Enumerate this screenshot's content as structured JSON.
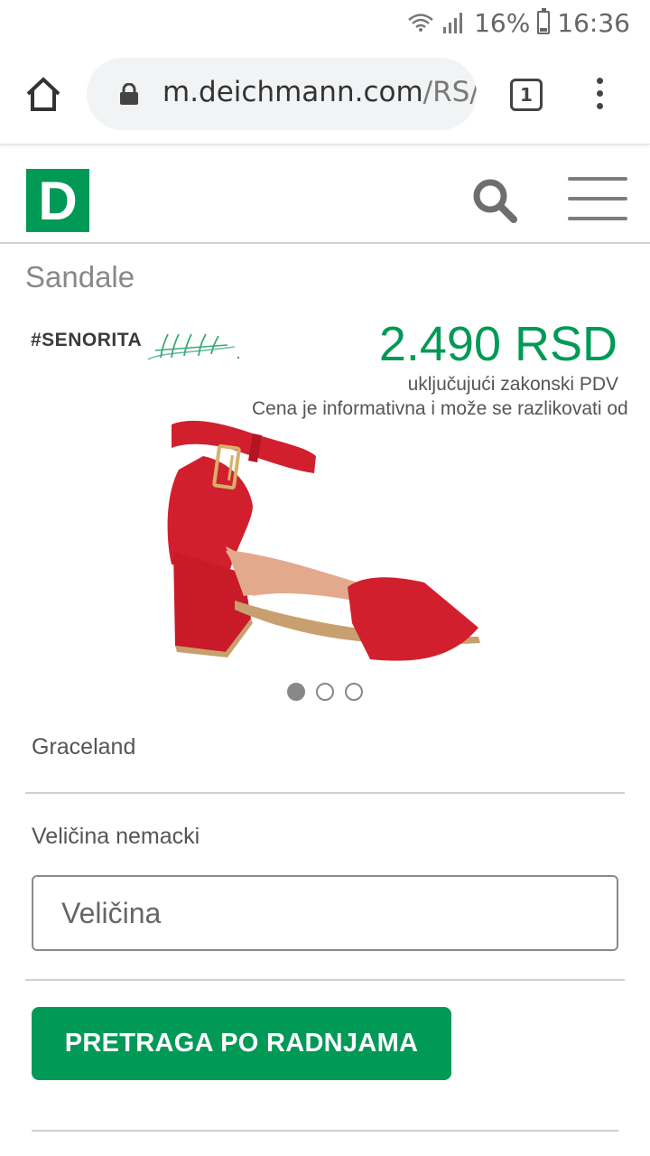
{
  "status_bar": {
    "battery": "16%",
    "time": "16:36",
    "icons": [
      "wifi-icon",
      "signal-icon",
      "battery-icon"
    ]
  },
  "browser": {
    "url_domain": "m.deichmann.com",
    "url_path": "/RS/",
    "tab_count": "1",
    "icons": [
      "home-icon",
      "lock-icon",
      "tabs-icon",
      "more-vert-icon"
    ]
  },
  "site": {
    "logo_letter": "D",
    "brand_color": "#009a56",
    "icons": [
      "search-icon",
      "menu-icon"
    ]
  },
  "product": {
    "category": "Sandale",
    "brand": "#SENORITA",
    "price": "2.490 RSD",
    "vat_note": "uključujući zakonski PDV",
    "info_note": "Cena je informativna i može se razlikovati od",
    "name": "Graceland",
    "image_dots": 3,
    "active_dot": 0
  },
  "size": {
    "label": "Veličina nemacki",
    "placeholder": "Veličina"
  },
  "actions": {
    "store_search": "PRETRAGA PO RADNJAMA"
  }
}
